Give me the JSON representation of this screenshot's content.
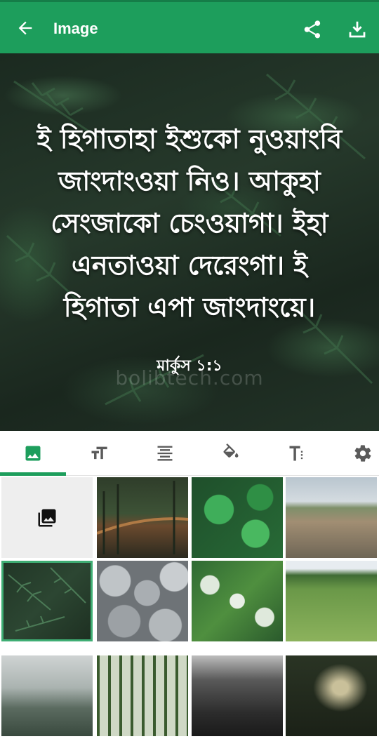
{
  "app_bar": {
    "title": "Image",
    "back_icon": "arrow-back-icon",
    "share_icon": "share-icon",
    "download_icon": "download-icon"
  },
  "preview": {
    "verse_lines": [
      "ই হিগাতাহা ইশুকো নুওয়াংবি",
      "জাংদাংওয়া নিও। আকুহা",
      "সেংজাকো চেংওয়াগা। ইহা",
      "এনতাওয়া দেরেংগা। ই",
      "হিগাতা এপা জাংদাংয়ে।"
    ],
    "reference": "মার্কুস ১:১",
    "watermark": "bolibtech.com"
  },
  "tabs": [
    {
      "name": "background",
      "icon": "image-icon",
      "selected": true
    },
    {
      "name": "font",
      "icon": "font-size-icon",
      "selected": false
    },
    {
      "name": "align",
      "icon": "text-align-icon",
      "selected": false
    },
    {
      "name": "color",
      "icon": "paint-bucket-icon",
      "selected": false
    },
    {
      "name": "text-style",
      "icon": "text-format-icon",
      "selected": false
    },
    {
      "name": "settings",
      "icon": "gear-icon",
      "selected": false
    }
  ],
  "grid": {
    "gallery_icon": "photo-library-icon",
    "thumbnails": [
      "forest-bridge",
      "green-clover",
      "river-field",
      "fern-leaves",
      "gray-stones",
      "tree-canopy",
      "wheat-field",
      "misty-mountain",
      "palm-trees",
      "city-street",
      "forest-path"
    ],
    "selected_thumbnail": "fern-leaves"
  },
  "colors": {
    "accent": "#1d9e5c",
    "selection": "#3fae74",
    "icon_gray": "#5b5b5b"
  }
}
